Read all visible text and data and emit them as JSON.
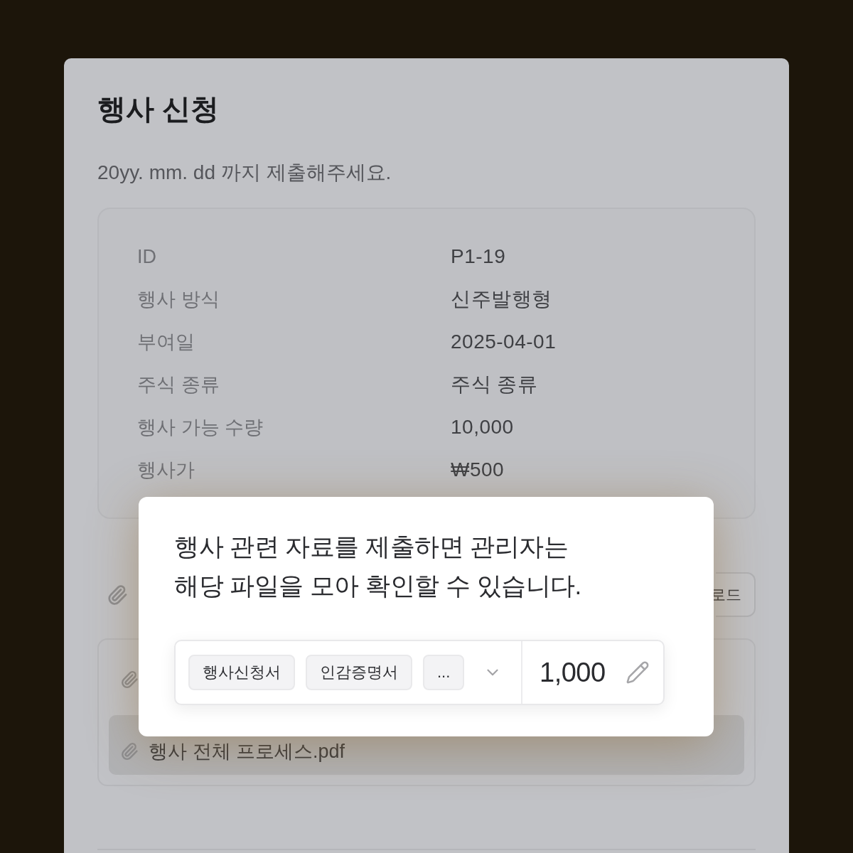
{
  "form": {
    "title": "행사 신청",
    "deadline_note": "20yy. mm. dd 까지 제출해주세요."
  },
  "details": [
    {
      "label": "ID",
      "value": "P1-19"
    },
    {
      "label": "행사 방식",
      "value": "신주발행형"
    },
    {
      "label": "부여일",
      "value": "2025-04-01"
    },
    {
      "label": "주식 종류",
      "value": "주식 종류"
    },
    {
      "label": "행사 가능 수량",
      "value": "10,000"
    },
    {
      "label": "행사가",
      "value": "₩500"
    }
  ],
  "upload": {
    "button": "로드"
  },
  "files": [
    {
      "selected": false
    },
    {
      "name": "행사 전체 프로세스.pdf",
      "selected": true
    }
  ],
  "popover": {
    "message": "행사 관련 자료를 제출하면 관리자는\n해당 파일을 모아 확인할 수 있습니다.",
    "tags": [
      "행사신청서",
      "인감증명서",
      "..."
    ],
    "quantity": "1,000"
  }
}
